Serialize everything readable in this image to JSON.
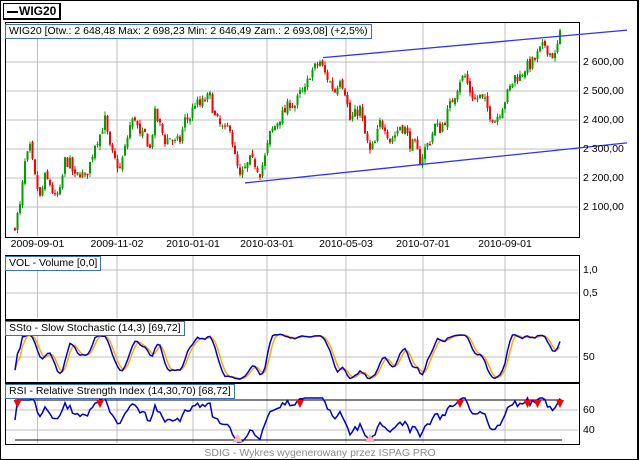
{
  "legend": {
    "symbol": "WIG20"
  },
  "footer": "SDIG - Wykres wygenerowany przez ISPAG PRO",
  "colors": {
    "up": "#00a000",
    "down": "#ff0000",
    "trend": "#3030ff",
    "stoch_k": "#0000c8",
    "stoch_d": "#ffaa00",
    "rsi": "#0000c8",
    "grid": "#c0c0c0"
  },
  "chart_data": [
    {
      "type": "candlestick",
      "title": "WIG20 [Otw.: 2 648,48  Max: 2 698,23  Min: 2 646,49  Zam.: 2 693,08] (+2,5%)",
      "ylim": [
        2000,
        2740
      ],
      "y_ticks": [
        {
          "v": 2600,
          "label": "2 600,00"
        },
        {
          "v": 2500,
          "label": "2 500,00"
        },
        {
          "v": 2400,
          "label": "2 400,00"
        },
        {
          "v": 2300,
          "label": "2 300,00"
        },
        {
          "v": 2200,
          "label": "2 200,00"
        },
        {
          "v": 2100,
          "label": "2 100,00"
        }
      ],
      "x_ticks": [
        {
          "pos": 4.5,
          "label": "2009-09-01"
        },
        {
          "pos": 20.4,
          "label": "2009-11-02"
        },
        {
          "pos": 35.6,
          "label": "2010-01-01"
        },
        {
          "pos": 50.4,
          "label": "2010-03-01"
        },
        {
          "pos": 66.2,
          "label": "2010-05-03"
        },
        {
          "pos": 81.6,
          "label": "2010-07-01"
        },
        {
          "pos": 98,
          "label": "2010-09-01"
        }
      ],
      "approx_closes_half_weekly": [
        2040,
        2100,
        2250,
        2300,
        2200,
        2130,
        2200,
        2180,
        2130,
        2150,
        2260,
        2250,
        2200,
        2220,
        2200,
        2250,
        2320,
        2350,
        2400,
        2300,
        2260,
        2230,
        2300,
        2380,
        2410,
        2340,
        2350,
        2300,
        2420,
        2380,
        2330,
        2340,
        2320,
        2330,
        2400,
        2410,
        2460,
        2450,
        2470,
        2480,
        2410,
        2380,
        2360,
        2380,
        2270,
        2200,
        2230,
        2260,
        2250,
        2220,
        2270,
        2350,
        2380,
        2410,
        2430,
        2460,
        2450,
        2490,
        2500,
        2560,
        2580,
        2600,
        2560,
        2530,
        2500,
        2550,
        2500,
        2400,
        2420,
        2440,
        2350,
        2290,
        2320,
        2390,
        2380,
        2330,
        2350,
        2380,
        2370,
        2320,
        2310,
        2260,
        2300,
        2330,
        2380,
        2370,
        2400,
        2450,
        2490,
        2540,
        2550,
        2500,
        2470,
        2480,
        2460,
        2420,
        2400,
        2430,
        2470,
        2510,
        2550,
        2550,
        2580,
        2590,
        2610,
        2640,
        2660,
        2630,
        2620,
        2693
      ],
      "trendlines": [
        {
          "name": "upper",
          "from": [
            61.6,
            2615
          ],
          "to": [
            122.4,
            2710
          ]
        },
        {
          "name": "lower",
          "from": [
            46,
            2183
          ],
          "to": [
            122.4,
            2321
          ]
        }
      ]
    },
    {
      "type": "bar",
      "title": "VOL - Volume [0,0]",
      "y_ticks": [
        {
          "v": 1.0,
          "label": "1,0"
        },
        {
          "v": 0.5,
          "label": "0,5"
        }
      ]
    },
    {
      "type": "line",
      "title": "SSto - Slow Stochastic (14,3) [69,72]",
      "params": [
        14,
        3
      ],
      "y_ticks": [
        {
          "v": 50,
          "label": "50"
        }
      ]
    },
    {
      "type": "line",
      "title": "RSI - Relative Strength Index (14,30,70) [68,72]",
      "params": [
        14,
        30,
        70
      ],
      "y_ticks": [
        {
          "v": 60,
          "label": "60"
        },
        {
          "v": 40,
          "label": "40"
        }
      ]
    }
  ]
}
